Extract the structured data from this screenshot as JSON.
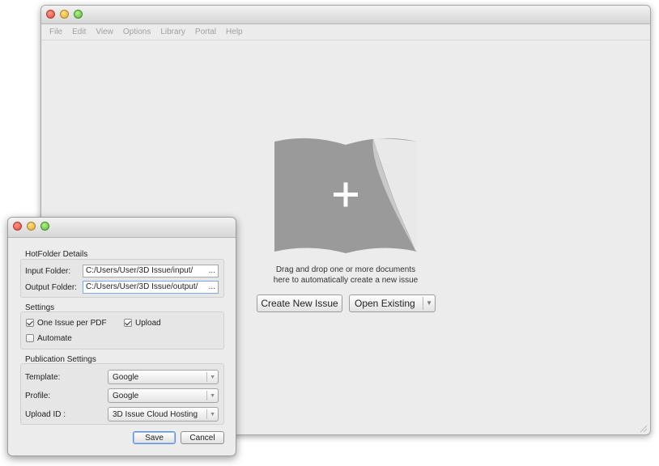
{
  "main": {
    "menu": [
      "File",
      "Edit",
      "View",
      "Options",
      "Library",
      "Portal",
      "Help"
    ],
    "drop_text_line1": "Drag and drop one or more documents",
    "drop_text_line2": "here to automatically create a new issue",
    "create_button": "Create New Issue",
    "open_button": "Open Existing"
  },
  "dialog": {
    "hotfolder": {
      "title": "HotFolder Details",
      "input_label": "Input Folder:",
      "input_value": "C:/Users/User/3D Issue/input/",
      "output_label": "Output Folder:",
      "output_value": "C:/Users/User/3D Issue/output/",
      "browse": "..."
    },
    "settings": {
      "title": "Settings",
      "one_issue_label": "One Issue per PDF",
      "one_issue_checked": true,
      "upload_label": "Upload",
      "upload_checked": true,
      "automate_label": "Automate",
      "automate_checked": false
    },
    "publication": {
      "title": "Publication Settings",
      "template_label": "Template:",
      "template_value": "Google",
      "profile_label": "Profile:",
      "profile_value": "Google",
      "upload_id_label": "Upload ID :",
      "upload_id_value": "3D Issue Cloud Hosting"
    },
    "save_button": "Save",
    "cancel_button": "Cancel"
  },
  "icons": {
    "close": "close-dot-icon",
    "minimize": "minimize-dot-icon",
    "zoom": "zoom-dot-icon",
    "drop": "open-book-plus-icon"
  },
  "colors": {
    "book": "#9a9a9a",
    "menu_disabled": "#a0a0a0",
    "window_bg": "#ececec"
  }
}
